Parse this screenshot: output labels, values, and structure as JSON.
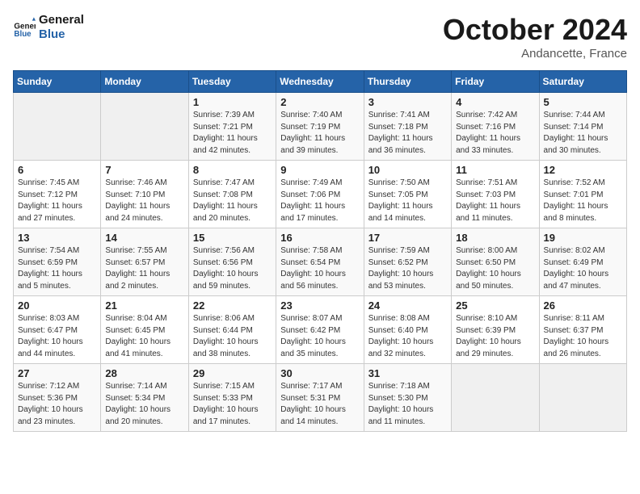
{
  "header": {
    "logo_line1": "General",
    "logo_line2": "Blue",
    "month": "October 2024",
    "location": "Andancette, France"
  },
  "weekdays": [
    "Sunday",
    "Monday",
    "Tuesday",
    "Wednesday",
    "Thursday",
    "Friday",
    "Saturday"
  ],
  "weeks": [
    [
      {
        "day": "",
        "info": ""
      },
      {
        "day": "",
        "info": ""
      },
      {
        "day": "1",
        "info": "Sunrise: 7:39 AM\nSunset: 7:21 PM\nDaylight: 11 hours\nand 42 minutes."
      },
      {
        "day": "2",
        "info": "Sunrise: 7:40 AM\nSunset: 7:19 PM\nDaylight: 11 hours\nand 39 minutes."
      },
      {
        "day": "3",
        "info": "Sunrise: 7:41 AM\nSunset: 7:18 PM\nDaylight: 11 hours\nand 36 minutes."
      },
      {
        "day": "4",
        "info": "Sunrise: 7:42 AM\nSunset: 7:16 PM\nDaylight: 11 hours\nand 33 minutes."
      },
      {
        "day": "5",
        "info": "Sunrise: 7:44 AM\nSunset: 7:14 PM\nDaylight: 11 hours\nand 30 minutes."
      }
    ],
    [
      {
        "day": "6",
        "info": "Sunrise: 7:45 AM\nSunset: 7:12 PM\nDaylight: 11 hours\nand 27 minutes."
      },
      {
        "day": "7",
        "info": "Sunrise: 7:46 AM\nSunset: 7:10 PM\nDaylight: 11 hours\nand 24 minutes."
      },
      {
        "day": "8",
        "info": "Sunrise: 7:47 AM\nSunset: 7:08 PM\nDaylight: 11 hours\nand 20 minutes."
      },
      {
        "day": "9",
        "info": "Sunrise: 7:49 AM\nSunset: 7:06 PM\nDaylight: 11 hours\nand 17 minutes."
      },
      {
        "day": "10",
        "info": "Sunrise: 7:50 AM\nSunset: 7:05 PM\nDaylight: 11 hours\nand 14 minutes."
      },
      {
        "day": "11",
        "info": "Sunrise: 7:51 AM\nSunset: 7:03 PM\nDaylight: 11 hours\nand 11 minutes."
      },
      {
        "day": "12",
        "info": "Sunrise: 7:52 AM\nSunset: 7:01 PM\nDaylight: 11 hours\nand 8 minutes."
      }
    ],
    [
      {
        "day": "13",
        "info": "Sunrise: 7:54 AM\nSunset: 6:59 PM\nDaylight: 11 hours\nand 5 minutes."
      },
      {
        "day": "14",
        "info": "Sunrise: 7:55 AM\nSunset: 6:57 PM\nDaylight: 11 hours\nand 2 minutes."
      },
      {
        "day": "15",
        "info": "Sunrise: 7:56 AM\nSunset: 6:56 PM\nDaylight: 10 hours\nand 59 minutes."
      },
      {
        "day": "16",
        "info": "Sunrise: 7:58 AM\nSunset: 6:54 PM\nDaylight: 10 hours\nand 56 minutes."
      },
      {
        "day": "17",
        "info": "Sunrise: 7:59 AM\nSunset: 6:52 PM\nDaylight: 10 hours\nand 53 minutes."
      },
      {
        "day": "18",
        "info": "Sunrise: 8:00 AM\nSunset: 6:50 PM\nDaylight: 10 hours\nand 50 minutes."
      },
      {
        "day": "19",
        "info": "Sunrise: 8:02 AM\nSunset: 6:49 PM\nDaylight: 10 hours\nand 47 minutes."
      }
    ],
    [
      {
        "day": "20",
        "info": "Sunrise: 8:03 AM\nSunset: 6:47 PM\nDaylight: 10 hours\nand 44 minutes."
      },
      {
        "day": "21",
        "info": "Sunrise: 8:04 AM\nSunset: 6:45 PM\nDaylight: 10 hours\nand 41 minutes."
      },
      {
        "day": "22",
        "info": "Sunrise: 8:06 AM\nSunset: 6:44 PM\nDaylight: 10 hours\nand 38 minutes."
      },
      {
        "day": "23",
        "info": "Sunrise: 8:07 AM\nSunset: 6:42 PM\nDaylight: 10 hours\nand 35 minutes."
      },
      {
        "day": "24",
        "info": "Sunrise: 8:08 AM\nSunset: 6:40 PM\nDaylight: 10 hours\nand 32 minutes."
      },
      {
        "day": "25",
        "info": "Sunrise: 8:10 AM\nSunset: 6:39 PM\nDaylight: 10 hours\nand 29 minutes."
      },
      {
        "day": "26",
        "info": "Sunrise: 8:11 AM\nSunset: 6:37 PM\nDaylight: 10 hours\nand 26 minutes."
      }
    ],
    [
      {
        "day": "27",
        "info": "Sunrise: 7:12 AM\nSunset: 5:36 PM\nDaylight: 10 hours\nand 23 minutes."
      },
      {
        "day": "28",
        "info": "Sunrise: 7:14 AM\nSunset: 5:34 PM\nDaylight: 10 hours\nand 20 minutes."
      },
      {
        "day": "29",
        "info": "Sunrise: 7:15 AM\nSunset: 5:33 PM\nDaylight: 10 hours\nand 17 minutes."
      },
      {
        "day": "30",
        "info": "Sunrise: 7:17 AM\nSunset: 5:31 PM\nDaylight: 10 hours\nand 14 minutes."
      },
      {
        "day": "31",
        "info": "Sunrise: 7:18 AM\nSunset: 5:30 PM\nDaylight: 10 hours\nand 11 minutes."
      },
      {
        "day": "",
        "info": ""
      },
      {
        "day": "",
        "info": ""
      }
    ]
  ]
}
